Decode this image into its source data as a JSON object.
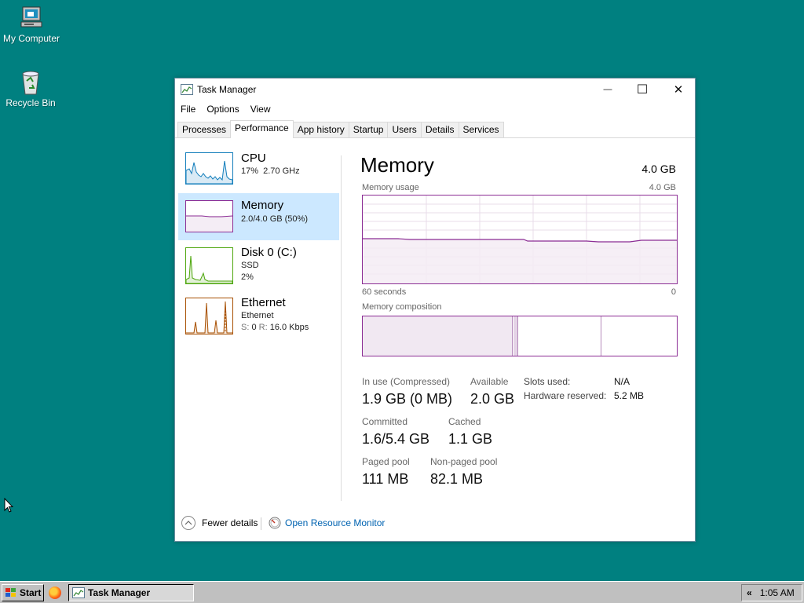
{
  "desktop": {
    "icons": [
      {
        "label": "My Computer",
        "icon": "computer-icon"
      },
      {
        "label": "Recycle Bin",
        "icon": "recycle-bin-icon"
      }
    ]
  },
  "window": {
    "title": "Task Manager",
    "controls": {
      "minimize": "—",
      "maximize": "☐",
      "close": "✕"
    },
    "menu": [
      "File",
      "Options",
      "View"
    ],
    "tabs": [
      "Processes",
      "Performance",
      "App history",
      "Startup",
      "Users",
      "Details",
      "Services"
    ],
    "active_tab": "Performance"
  },
  "sidebar": [
    {
      "name": "CPU",
      "line1": "17%  2.70 GHz",
      "line2": "",
      "color": "#117dbb"
    },
    {
      "name": "Memory",
      "line1": "2.0/4.0 GB (50%)",
      "line2": "",
      "color": "#8b2c94"
    },
    {
      "name": "Disk 0 (C:)",
      "line1": "SSD",
      "line2": "2%",
      "color": "#4da60c"
    },
    {
      "name": "Ethernet",
      "line1": "Ethernet",
      "line2_label_s": "S:",
      "line2_s": "0",
      "line2_label_r": "R:",
      "line2_r": "16.0 Kbps",
      "color": "#a74f01"
    }
  ],
  "main": {
    "title": "Memory",
    "total": "4.0 GB",
    "usage_label": "Memory usage",
    "usage_max": "4.0 GB",
    "axis_left": "60 seconds",
    "axis_right": "0",
    "composition_label": "Memory composition",
    "stats": {
      "in_use_label": "In use (Compressed)",
      "in_use": "1.9 GB (0 MB)",
      "available_label": "Available",
      "available": "2.0 GB",
      "committed_label": "Committed",
      "committed": "1.6/5.4 GB",
      "cached_label": "Cached",
      "cached": "1.1 GB",
      "paged_label": "Paged pool",
      "paged": "111 MB",
      "nonpaged_label": "Non-paged pool",
      "nonpaged": "82.1 MB"
    },
    "kv": {
      "slots_label": "Slots used:",
      "slots": "N/A",
      "hw_label": "Hardware reserved:",
      "hw": "5.2 MB"
    }
  },
  "footer": {
    "fewer": "Fewer details",
    "monitor": "Open Resource Monitor"
  },
  "taskbar": {
    "start": "Start",
    "task": "Task Manager",
    "chevron": "«",
    "clock": "1:05 AM"
  },
  "colors": {
    "desktop": "#008080",
    "memory": "#8b2c94",
    "selected": "#cce8ff",
    "link": "#0063b1"
  }
}
